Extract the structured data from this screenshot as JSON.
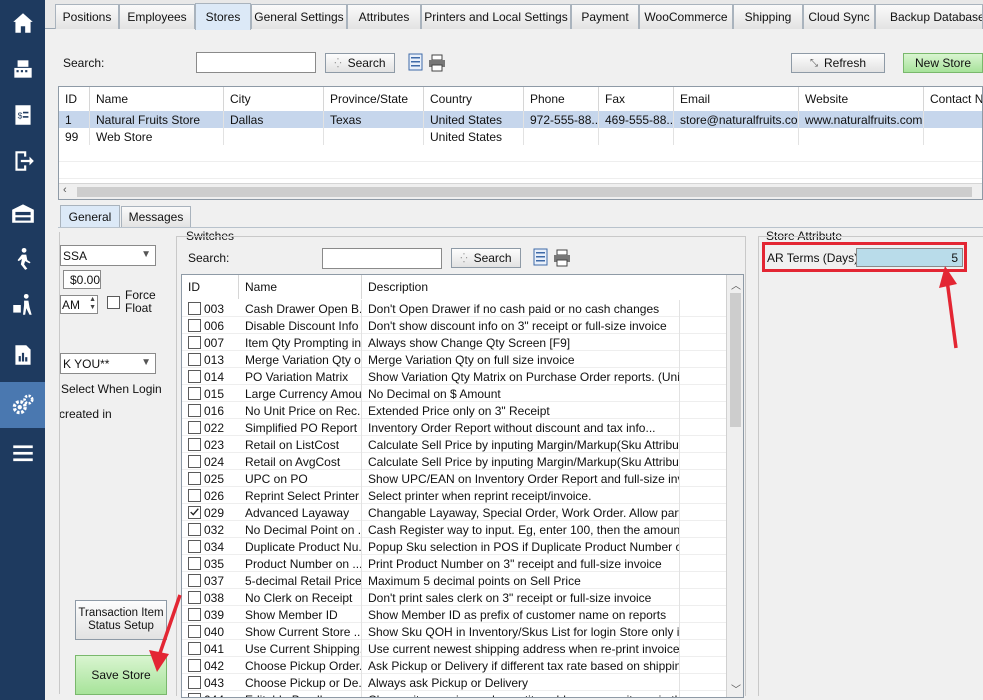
{
  "sidebar": {
    "items": [
      {
        "icon": "home-icon"
      },
      {
        "icon": "cash-register-icon"
      },
      {
        "icon": "invoice-icon"
      },
      {
        "icon": "sign-out-icon"
      },
      {
        "icon": "warehouse-icon"
      },
      {
        "icon": "walking-person-icon"
      },
      {
        "icon": "delivery-person-icon"
      },
      {
        "icon": "report-icon"
      },
      {
        "icon": "settings-gears-icon"
      },
      {
        "icon": "menu-icon"
      }
    ]
  },
  "tabs": [
    {
      "label": "Positions"
    },
    {
      "label": "Employees"
    },
    {
      "label": "Stores"
    },
    {
      "label": "General Settings"
    },
    {
      "label": "Attributes"
    },
    {
      "label": "Printers and Local Settings"
    },
    {
      "label": "Payment"
    },
    {
      "label": "WooCommerce"
    },
    {
      "label": "Shipping"
    },
    {
      "label": "Cloud Sync"
    },
    {
      "label": "Backup Database"
    }
  ],
  "stores": {
    "search_label": "Search:",
    "search_value": "",
    "search_button": "Search",
    "refresh_button": "Refresh",
    "new_store_button": "New Store",
    "columns": [
      "ID",
      "Name",
      "City",
      "Province/State",
      "Country",
      "Phone",
      "Fax",
      "Email",
      "Website",
      "Contact Na"
    ],
    "rows": [
      [
        "1",
        "Natural Fruits Store",
        "Dallas",
        "Texas",
        "United States",
        "972-555-88...",
        "469-555-88...",
        "store@naturalfruits.com",
        "www.naturalfruits.com",
        ""
      ],
      [
        "99",
        "Web Store",
        "",
        "",
        "United States",
        "",
        "",
        "",
        "",
        ""
      ]
    ]
  },
  "subtabs": [
    {
      "label": "General"
    },
    {
      "label": "Messages"
    }
  ],
  "left_panel": {
    "dropdown1": "SSA",
    "amount": "$0.00",
    "time_suffix": "AM",
    "force_float": "Force\nFloat",
    "force_float_line1": "Force",
    "force_float_line2": "Float",
    "dropdown2": "K YOU**",
    "select_when_login": "Select When Login",
    "created_in": "created in",
    "transaction_button_line1": "Transaction Item",
    "transaction_button_line2": "Status Setup",
    "save_button": "Save Store"
  },
  "switches": {
    "group_label": "Switches",
    "search_label": "Search:",
    "search_value": "",
    "search_button": "Search",
    "columns": [
      "ID",
      "Name",
      "Description"
    ],
    "rows": [
      {
        "id": "003",
        "name": "Cash Drawer Open B...",
        "desc": "Don't Open Drawer if no cash paid or no cash changes",
        "checked": false
      },
      {
        "id": "006",
        "name": "Disable Discount Info",
        "desc": "Don't show discount info on 3\" receipt or full-size invoice",
        "checked": false
      },
      {
        "id": "007",
        "name": "Item Qty Prompting in...",
        "desc": "Always show Change Qty Screen [F9]",
        "checked": false
      },
      {
        "id": "013",
        "name": "Merge Variation Qty o...",
        "desc": "Merge Variation Qty on full size invoice",
        "checked": false
      },
      {
        "id": "014",
        "name": "PO Variation Matrix",
        "desc": "Show Variation Qty Matrix on Purchase Order reports. (Unique ...",
        "checked": false
      },
      {
        "id": "015",
        "name": "Large Currency Amount",
        "desc": "No Decimal on $ Amount",
        "checked": false
      },
      {
        "id": "016",
        "name": "No Unit Price on Rec...",
        "desc": "Extended Price only on 3\" Receipt",
        "checked": false
      },
      {
        "id": "022",
        "name": "Simplified PO Report",
        "desc": "Inventory Order Report without discount and tax info...",
        "checked": false
      },
      {
        "id": "023",
        "name": "Retail on ListCost",
        "desc": "Calculate Sell Price by inputing Margin/Markup(Sku Attribute) b...",
        "checked": false
      },
      {
        "id": "024",
        "name": "Retail on AvgCost",
        "desc": "Calculate Sell Price by inputing Margin/Markup(Sku Attribute) b...",
        "checked": false
      },
      {
        "id": "025",
        "name": "UPC on PO",
        "desc": "Show UPC/EAN on Inventory Order Report and full-size invoice",
        "checked": false
      },
      {
        "id": "026",
        "name": "Reprint Select Printer",
        "desc": "Select printer when reprint receipt/invoice.",
        "checked": false
      },
      {
        "id": "029",
        "name": "Advanced Layaway",
        "desc": "Changable Layaway, Special Order, Work Order. Allow partial I...",
        "checked": true
      },
      {
        "id": "032",
        "name": "No Decimal Point on ...",
        "desc": "Cash Register way to input. Eg, enter 100, then the amount is $...",
        "checked": false
      },
      {
        "id": "034",
        "name": "Duplicate Product Nu...",
        "desc": "Popup Sku selection in POS if Duplicate Product Number or Gr...",
        "checked": false
      },
      {
        "id": "035",
        "name": "Product Number on ...",
        "desc": "Print Product Number on 3\" receipt and full-size invoice",
        "checked": false
      },
      {
        "id": "037",
        "name": "5-decimal Retail Price",
        "desc": "Maximum 5 decimal points on Sell Price",
        "checked": false
      },
      {
        "id": "038",
        "name": "No Clerk on Receipt",
        "desc": "Don't print sales clerk on 3\" receipt or full-size invoice",
        "checked": false
      },
      {
        "id": "039",
        "name": "Show Member ID",
        "desc": "Show Member ID as prefix of customer name on reports",
        "checked": false
      },
      {
        "id": "040",
        "name": "Show Current Store ...",
        "desc": "Show Sku QOH in Inventory/Skus List for login Store only inste...",
        "checked": false
      },
      {
        "id": "041",
        "name": "Use Current Shipping...",
        "desc": "Use current newest shipping address when re-print invoice",
        "checked": false
      },
      {
        "id": "042",
        "name": "Choose Pickup Order...",
        "desc": "Ask Pickup or Delivery if different tax rate based on shipping ad...",
        "checked": false
      },
      {
        "id": "043",
        "name": "Choose Pickup or De...",
        "desc": "Always ask Pickup or Delivery",
        "checked": false
      },
      {
        "id": "044",
        "name": "Editable Bundle",
        "desc": "Change items price and quantity, add or remove items in the Bu...",
        "checked": false
      }
    ]
  },
  "store_attribute": {
    "group_label": "Store Attribute",
    "ar_terms_label": "AR Terms (Days):",
    "ar_terms_value": "5"
  },
  "colors": {
    "sidebar": "#1e3a5f",
    "sidebar_active": "#4a78b0",
    "highlight": "#e32633",
    "selected_row": "#c6d6ec",
    "green_button": "#a7e39a"
  }
}
